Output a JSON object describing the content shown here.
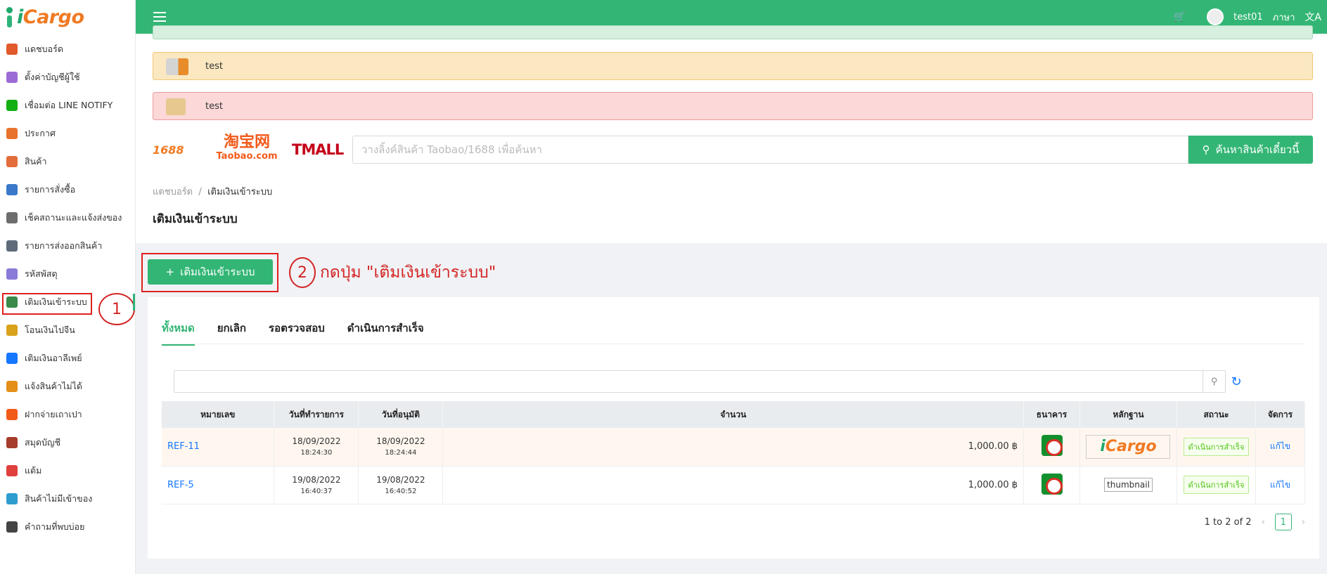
{
  "app": {
    "logo_text": "Cargo",
    "logo_i": "i"
  },
  "sidebar": {
    "items": [
      {
        "label": "แดชบอร์ด",
        "icon": "dashboard-icon",
        "color": "#e05a2b"
      },
      {
        "label": "ตั้งค่าบัญชีผู้ใช้",
        "icon": "user-settings-icon",
        "color": "#9b6bd6"
      },
      {
        "label": "เชื่อมต่อ LINE NOTIFY",
        "icon": "line-icon",
        "color": "#13b013"
      },
      {
        "label": "ประกาศ",
        "icon": "megaphone-icon",
        "color": "#e8732c"
      },
      {
        "label": "สินค้า",
        "icon": "bag-icon",
        "color": "#e36d3b"
      },
      {
        "label": "รายการสั่งซื้อ",
        "icon": "order-icon",
        "color": "#3a79c9"
      },
      {
        "label": "เช็คสถานะและแจ้งส่งของ",
        "icon": "status-icon",
        "color": "#6d6d6d"
      },
      {
        "label": "รายการส่งออกสินค้า",
        "icon": "truck-icon",
        "color": "#5e6a79"
      },
      {
        "label": "รหัสพัสดุ",
        "icon": "parcel-icon",
        "color": "#8a7bd8"
      },
      {
        "label": "เติมเงินเข้าระบบ",
        "icon": "wallet-icon",
        "color": "#3c8a4a"
      },
      {
        "label": "โอนเงินไปจีน",
        "icon": "coin-icon",
        "color": "#d9a21b"
      },
      {
        "label": "เติมเงินอาลีเพย์",
        "icon": "alipay-icon",
        "color": "#1677ff"
      },
      {
        "label": "แจ้งสินค้าไม่ได้",
        "icon": "report-icon",
        "color": "#e38f1a"
      },
      {
        "label": "ฝากจ่ายเถาเปา",
        "icon": "taobao-icon",
        "color": "#f25a1a"
      },
      {
        "label": "สมุดบัญชี",
        "icon": "account-book-icon",
        "color": "#a63c2c"
      },
      {
        "label": "แต้ม",
        "icon": "points-icon",
        "color": "#e0403c"
      },
      {
        "label": "สินค้าไม่มีเข้าของ",
        "icon": "no-owner-icon",
        "color": "#2e9ccf"
      },
      {
        "label": "คำถามที่พบบ่อย",
        "icon": "faq-icon",
        "color": "#444444"
      }
    ],
    "active_index": 9,
    "annotation_1": "1"
  },
  "topbar": {
    "username": "test01",
    "language": "ภาษา"
  },
  "alerts": {
    "yellow_text": "test",
    "red_text": "test"
  },
  "brands": {
    "b1688": "1688",
    "taobao": "淘宝网",
    "taobao_sub": "Taobao.com",
    "tmall": "TMALL"
  },
  "search": {
    "placeholder": "วางลิ้งค์สินค้า Taobao/1688 เพื่อค้นหา",
    "button": "ค้นหาสินค้าเดี๋ยวนี้"
  },
  "breadcrumb": {
    "home": "แดชบอร์ด",
    "sep": "/",
    "current": "เติมเงินเข้าระบบ"
  },
  "page_title": "เติมเงินเข้าระบบ",
  "add_button": "เติมเงินเข้าระบบ",
  "annotation_2": {
    "num": "2",
    "text": "กดปุ่ม \"เติมเงินเข้าระบบ\""
  },
  "tabs": [
    "ทั้งหมด",
    "ยกเลิก",
    "รอตรวจสอบ",
    "ดำเนินการสำเร็จ"
  ],
  "table": {
    "headers": [
      "หมายเลข",
      "วันที่ทำรายการ",
      "วันที่อนุมัติ",
      "จำนวน",
      "ธนาคาร",
      "หลักฐาน",
      "สถานะ",
      "จัดการ"
    ],
    "rows": [
      {
        "ref": "REF-11",
        "created_date": "18/09/2022",
        "created_time": "18:24:30",
        "approved_date": "18/09/2022",
        "approved_time": "18:24:44",
        "amount": "1,000.00 ฿",
        "proof": "Cargo",
        "status": "ดำเนินการสำเร็จ",
        "action": "แก้ไข"
      },
      {
        "ref": "REF-5",
        "created_date": "19/08/2022",
        "created_time": "16:40:37",
        "approved_date": "19/08/2022",
        "approved_time": "16:40:52",
        "amount": "1,000.00 ฿",
        "proof": "thumbnail",
        "status": "ดำเนินการสำเร็จ",
        "action": "แก้ไข"
      }
    ]
  },
  "pagination": {
    "summary": "1 to 2 of 2",
    "current": "1"
  }
}
